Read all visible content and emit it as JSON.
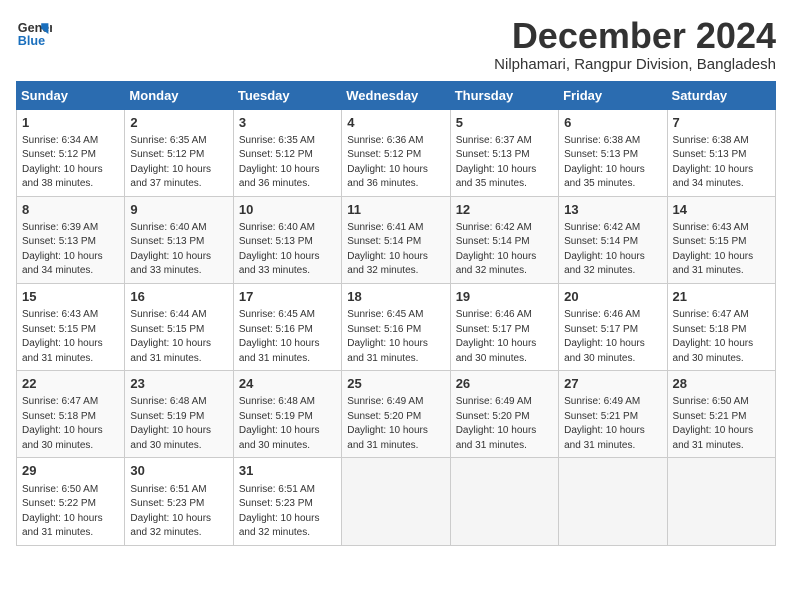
{
  "logo": {
    "line1": "General",
    "line2": "Blue"
  },
  "title": "December 2024",
  "subtitle": "Nilphamari, Rangpur Division, Bangladesh",
  "days_of_week": [
    "Sunday",
    "Monday",
    "Tuesday",
    "Wednesday",
    "Thursday",
    "Friday",
    "Saturday"
  ],
  "weeks": [
    [
      {
        "day": 1,
        "sunrise": "6:34 AM",
        "sunset": "5:12 PM",
        "daylight": "10 hours and 38 minutes."
      },
      {
        "day": 2,
        "sunrise": "6:35 AM",
        "sunset": "5:12 PM",
        "daylight": "10 hours and 37 minutes."
      },
      {
        "day": 3,
        "sunrise": "6:35 AM",
        "sunset": "5:12 PM",
        "daylight": "10 hours and 36 minutes."
      },
      {
        "day": 4,
        "sunrise": "6:36 AM",
        "sunset": "5:12 PM",
        "daylight": "10 hours and 36 minutes."
      },
      {
        "day": 5,
        "sunrise": "6:37 AM",
        "sunset": "5:13 PM",
        "daylight": "10 hours and 35 minutes."
      },
      {
        "day": 6,
        "sunrise": "6:38 AM",
        "sunset": "5:13 PM",
        "daylight": "10 hours and 35 minutes."
      },
      {
        "day": 7,
        "sunrise": "6:38 AM",
        "sunset": "5:13 PM",
        "daylight": "10 hours and 34 minutes."
      }
    ],
    [
      {
        "day": 8,
        "sunrise": "6:39 AM",
        "sunset": "5:13 PM",
        "daylight": "10 hours and 34 minutes."
      },
      {
        "day": 9,
        "sunrise": "6:40 AM",
        "sunset": "5:13 PM",
        "daylight": "10 hours and 33 minutes."
      },
      {
        "day": 10,
        "sunrise": "6:40 AM",
        "sunset": "5:13 PM",
        "daylight": "10 hours and 33 minutes."
      },
      {
        "day": 11,
        "sunrise": "6:41 AM",
        "sunset": "5:14 PM",
        "daylight": "10 hours and 32 minutes."
      },
      {
        "day": 12,
        "sunrise": "6:42 AM",
        "sunset": "5:14 PM",
        "daylight": "10 hours and 32 minutes."
      },
      {
        "day": 13,
        "sunrise": "6:42 AM",
        "sunset": "5:14 PM",
        "daylight": "10 hours and 32 minutes."
      },
      {
        "day": 14,
        "sunrise": "6:43 AM",
        "sunset": "5:15 PM",
        "daylight": "10 hours and 31 minutes."
      }
    ],
    [
      {
        "day": 15,
        "sunrise": "6:43 AM",
        "sunset": "5:15 PM",
        "daylight": "10 hours and 31 minutes."
      },
      {
        "day": 16,
        "sunrise": "6:44 AM",
        "sunset": "5:15 PM",
        "daylight": "10 hours and 31 minutes."
      },
      {
        "day": 17,
        "sunrise": "6:45 AM",
        "sunset": "5:16 PM",
        "daylight": "10 hours and 31 minutes."
      },
      {
        "day": 18,
        "sunrise": "6:45 AM",
        "sunset": "5:16 PM",
        "daylight": "10 hours and 31 minutes."
      },
      {
        "day": 19,
        "sunrise": "6:46 AM",
        "sunset": "5:17 PM",
        "daylight": "10 hours and 30 minutes."
      },
      {
        "day": 20,
        "sunrise": "6:46 AM",
        "sunset": "5:17 PM",
        "daylight": "10 hours and 30 minutes."
      },
      {
        "day": 21,
        "sunrise": "6:47 AM",
        "sunset": "5:18 PM",
        "daylight": "10 hours and 30 minutes."
      }
    ],
    [
      {
        "day": 22,
        "sunrise": "6:47 AM",
        "sunset": "5:18 PM",
        "daylight": "10 hours and 30 minutes."
      },
      {
        "day": 23,
        "sunrise": "6:48 AM",
        "sunset": "5:19 PM",
        "daylight": "10 hours and 30 minutes."
      },
      {
        "day": 24,
        "sunrise": "6:48 AM",
        "sunset": "5:19 PM",
        "daylight": "10 hours and 30 minutes."
      },
      {
        "day": 25,
        "sunrise": "6:49 AM",
        "sunset": "5:20 PM",
        "daylight": "10 hours and 31 minutes."
      },
      {
        "day": 26,
        "sunrise": "6:49 AM",
        "sunset": "5:20 PM",
        "daylight": "10 hours and 31 minutes."
      },
      {
        "day": 27,
        "sunrise": "6:49 AM",
        "sunset": "5:21 PM",
        "daylight": "10 hours and 31 minutes."
      },
      {
        "day": 28,
        "sunrise": "6:50 AM",
        "sunset": "5:21 PM",
        "daylight": "10 hours and 31 minutes."
      }
    ],
    [
      {
        "day": 29,
        "sunrise": "6:50 AM",
        "sunset": "5:22 PM",
        "daylight": "10 hours and 31 minutes."
      },
      {
        "day": 30,
        "sunrise": "6:51 AM",
        "sunset": "5:23 PM",
        "daylight": "10 hours and 32 minutes."
      },
      {
        "day": 31,
        "sunrise": "6:51 AM",
        "sunset": "5:23 PM",
        "daylight": "10 hours and 32 minutes."
      },
      null,
      null,
      null,
      null
    ]
  ]
}
